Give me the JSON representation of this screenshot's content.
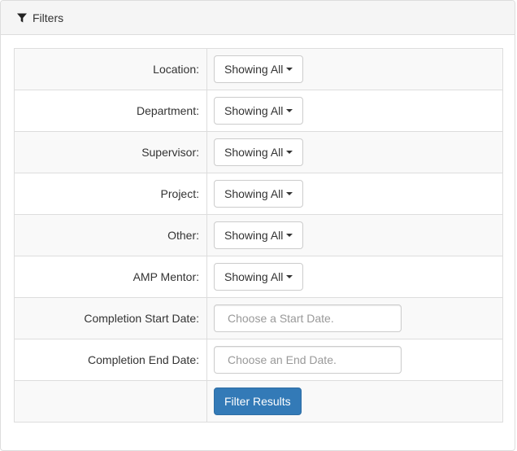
{
  "panel": {
    "title": "Filters",
    "icon": "filter-icon"
  },
  "filters": [
    {
      "label": "Location:",
      "type": "dropdown",
      "value": "Showing All"
    },
    {
      "label": "Department:",
      "type": "dropdown",
      "value": "Showing All"
    },
    {
      "label": "Supervisor:",
      "type": "dropdown",
      "value": "Showing All"
    },
    {
      "label": "Project:",
      "type": "dropdown",
      "value": "Showing All"
    },
    {
      "label": "Other:",
      "type": "dropdown",
      "value": "Showing All"
    },
    {
      "label": "AMP Mentor:",
      "type": "dropdown",
      "value": "Showing All"
    },
    {
      "label": "Completion Start Date:",
      "type": "date",
      "value": "",
      "placeholder": "Choose a Start Date."
    },
    {
      "label": "Completion End Date:",
      "type": "date",
      "value": "",
      "placeholder": "Choose an End Date."
    }
  ],
  "actions": {
    "submit_label": "Filter Results"
  },
  "colors": {
    "primary": "#337ab7",
    "border": "#dddddd",
    "heading_bg": "#f5f5f5",
    "stripe_bg": "#f9f9f9"
  }
}
